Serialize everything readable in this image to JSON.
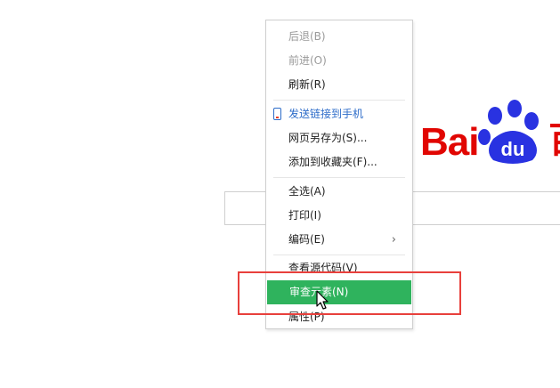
{
  "logo": {
    "bai_text": "Bai",
    "du_text": "du",
    "cn_text": "百",
    "brand_red": "#e10602",
    "brand_blue": "#2932e1"
  },
  "menu": {
    "back": "后退(B)",
    "forward": "前进(O)",
    "refresh": "刷新(R)",
    "send_to_phone": "发送链接到手机",
    "save_as": "网页另存为(S)...",
    "add_favorites": "添加到收藏夹(F)...",
    "select_all": "全选(A)",
    "print": "打印(I)",
    "encoding": "编码(E)",
    "view_source": "查看源代码(V)",
    "inspect": "审查元素(N)",
    "properties": "属性(P)",
    "highlight_color": "#2fb35d"
  },
  "annotation": {
    "rect_color": "#e8403c"
  }
}
